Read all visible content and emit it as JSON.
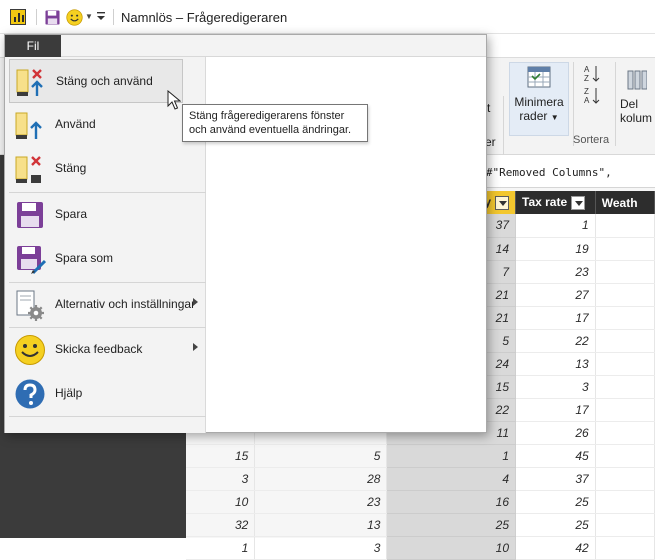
{
  "window": {
    "title": "Namnlös – Frågeredigeraren"
  },
  "ribbon": {
    "partial_left_labels": [
      "rt",
      "er"
    ],
    "reduce_rows": {
      "line1": "Minimera",
      "line2": "rader"
    },
    "group_sort_label": "Sortera",
    "delete_columns_partial": {
      "line1": "Del",
      "line2": "kolum"
    }
  },
  "formula": {
    "text_partial": "es(#\"Removed Columns\","
  },
  "grid": {
    "columns": [
      {
        "label": "",
        "filter": false
      },
      {
        "label": "",
        "filter": false
      },
      {
        "label": "ty",
        "filter": true,
        "selected": true
      },
      {
        "label": "Tax rate",
        "filter": true
      },
      {
        "label": "Weath",
        "filter": false
      }
    ],
    "rows": [
      [
        "",
        "",
        "37",
        "1",
        ""
      ],
      [
        "",
        "",
        "14",
        "19",
        ""
      ],
      [
        "",
        "",
        "7",
        "23",
        ""
      ],
      [
        "",
        "",
        "21",
        "27",
        ""
      ],
      [
        "",
        "",
        "21",
        "17",
        ""
      ],
      [
        "",
        "",
        "5",
        "22",
        ""
      ],
      [
        "",
        "",
        "24",
        "13",
        ""
      ],
      [
        "",
        "",
        "15",
        "3",
        ""
      ],
      [
        "",
        "",
        "22",
        "17",
        ""
      ],
      [
        "",
        "",
        "11",
        "26",
        ""
      ],
      [
        "15",
        "5",
        "1",
        "45",
        ""
      ],
      [
        "3",
        "28",
        "4",
        "37",
        ""
      ],
      [
        "10",
        "23",
        "16",
        "25",
        ""
      ],
      [
        "32",
        "13",
        "25",
        "25",
        ""
      ],
      [
        "1",
        "3",
        "10",
        "42",
        ""
      ]
    ]
  },
  "file_menu": {
    "tab_label": "Fil",
    "items": [
      {
        "label": "Stäng och använd",
        "icon": "close-and-apply-icon",
        "hover": true
      },
      {
        "label": "Använd",
        "icon": "apply-icon"
      },
      {
        "label": "Stäng",
        "icon": "close-doc-icon"
      },
      {
        "label": "Spara",
        "icon": "save-icon"
      },
      {
        "label": "Spara som",
        "icon": "save-as-icon"
      },
      {
        "label": "Alternativ och inställningar",
        "icon": "options-gear-icon",
        "submenu": true
      },
      {
        "label": "Skicka feedback",
        "icon": "smiley-icon",
        "submenu": true
      },
      {
        "label": "Hjälp",
        "icon": "help-icon"
      }
    ]
  },
  "tooltip": {
    "line1": "Stäng frågeredigerarens fönster",
    "line2": "och använd eventuella ändringar."
  },
  "colors": {
    "accent_yellow": "#f3c72e",
    "save_purple": "#7c3f98",
    "error_red": "#d13438",
    "apply_blue": "#1f6fb5"
  }
}
